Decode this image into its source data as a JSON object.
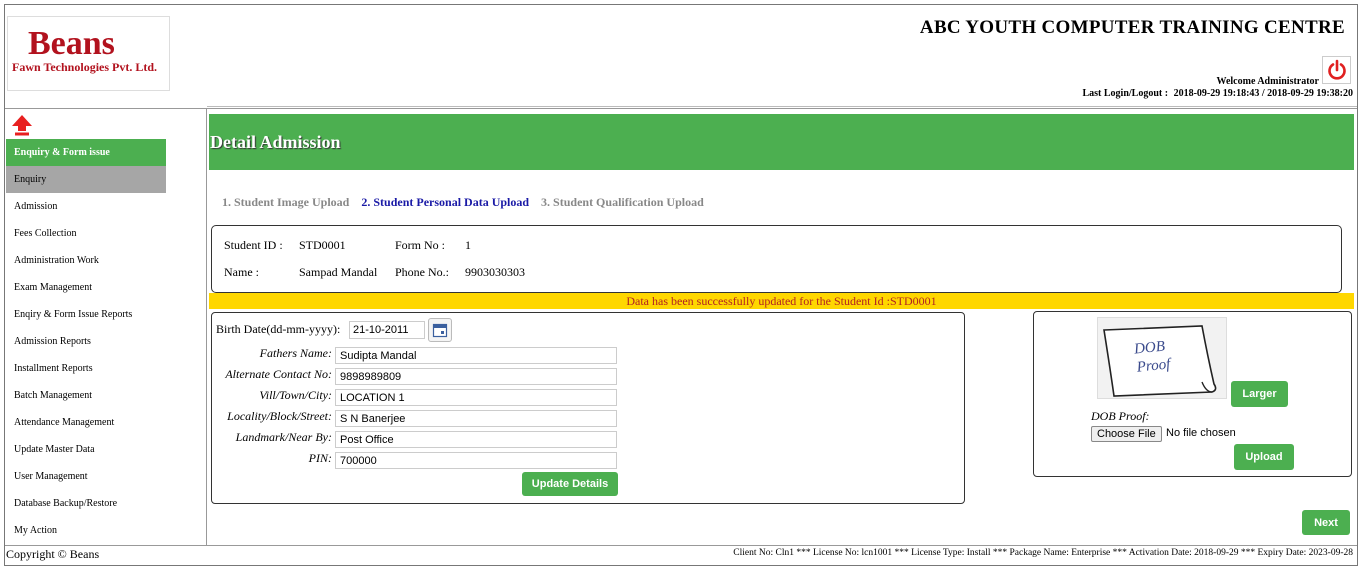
{
  "header": {
    "logo_main": "Beans",
    "logo_sub": "Fawn Technologies Pvt. Ltd.",
    "app_title": "ABC YOUTH COMPUTER TRAINING CENTRE",
    "welcome": "Welcome Administrator",
    "last_login_label": "Last Login/Logout :",
    "last_login_value": "2018-09-29 19:18:43 / 2018-09-29 19:38:20",
    "power_icon": "power-icon"
  },
  "sidebar": {
    "up_icon": "up-arrow-icon",
    "items": [
      {
        "label": "Enquiry & Form issue"
      },
      {
        "label": "Enquiry"
      },
      {
        "label": "Admission"
      },
      {
        "label": "Fees Collection"
      },
      {
        "label": "Administration Work"
      },
      {
        "label": "Exam Management"
      },
      {
        "label": "Enqiry & Form Issue Reports"
      },
      {
        "label": "Admission Reports"
      },
      {
        "label": "Installment Reports"
      },
      {
        "label": "Batch Management"
      },
      {
        "label": "Attendance Management"
      },
      {
        "label": "Update Master Data"
      },
      {
        "label": "User Management"
      },
      {
        "label": "Database Backup/Restore"
      },
      {
        "label": "My Action"
      }
    ]
  },
  "main": {
    "title": "Detail Admission",
    "steps": [
      {
        "label": "1. Student Image Upload"
      },
      {
        "label": "2. Student Personal Data Upload"
      },
      {
        "label": "3. Student Qualification Upload"
      }
    ],
    "student": {
      "id_label": "Student ID :",
      "id_value": "STD0001",
      "form_label": "Form No :",
      "form_value": "1",
      "name_label": "Name :",
      "name_value": "Sampad Mandal",
      "phone_label": "Phone No.:",
      "phone_value": "9903030303"
    },
    "success_message": "Data has been successfully updated for the Student Id :STD0001",
    "form": {
      "birth_label": "Birth Date(dd-mm-yyyy):",
      "birth_value": "21-10-2011",
      "calendar_icon": "calendar-icon",
      "fields": [
        {
          "label": "Fathers Name:",
          "value": "Sudipta Mandal"
        },
        {
          "label": "Alternate Contact No:",
          "value": "9898989809"
        },
        {
          "label": "Vill/Town/City:",
          "value": "LOCATION 1"
        },
        {
          "label": "Locality/Block/Street:",
          "value": "S N Banerjee"
        },
        {
          "label": "Landmark/Near By:",
          "value": "Post Office"
        },
        {
          "label": "PIN:",
          "value": "700000"
        }
      ],
      "update_button": "Update Details"
    },
    "proof": {
      "image_text_line1": "DOB",
      "image_text_line2": "Proof",
      "larger_button": "Larger",
      "dob_label": "DOB Proof:",
      "choose_button": "Choose File",
      "no_file_text": "No file chosen",
      "upload_button": "Upload"
    },
    "next_button": "Next"
  },
  "footer": {
    "copyright": "Copyright © Beans",
    "license": "Client No: Cln1 *** License No: lcn1001 *** License Type: Install *** Package Name: Enterprise *** Activation Date: 2018-09-29 *** Expiry Date: 2023-09-28"
  },
  "colors": {
    "accent_green": "#4caf50",
    "brand_red": "#b2121e",
    "success_bar": "#ffd700",
    "success_text": "#b22222",
    "step_current": "#1a1aa6"
  }
}
